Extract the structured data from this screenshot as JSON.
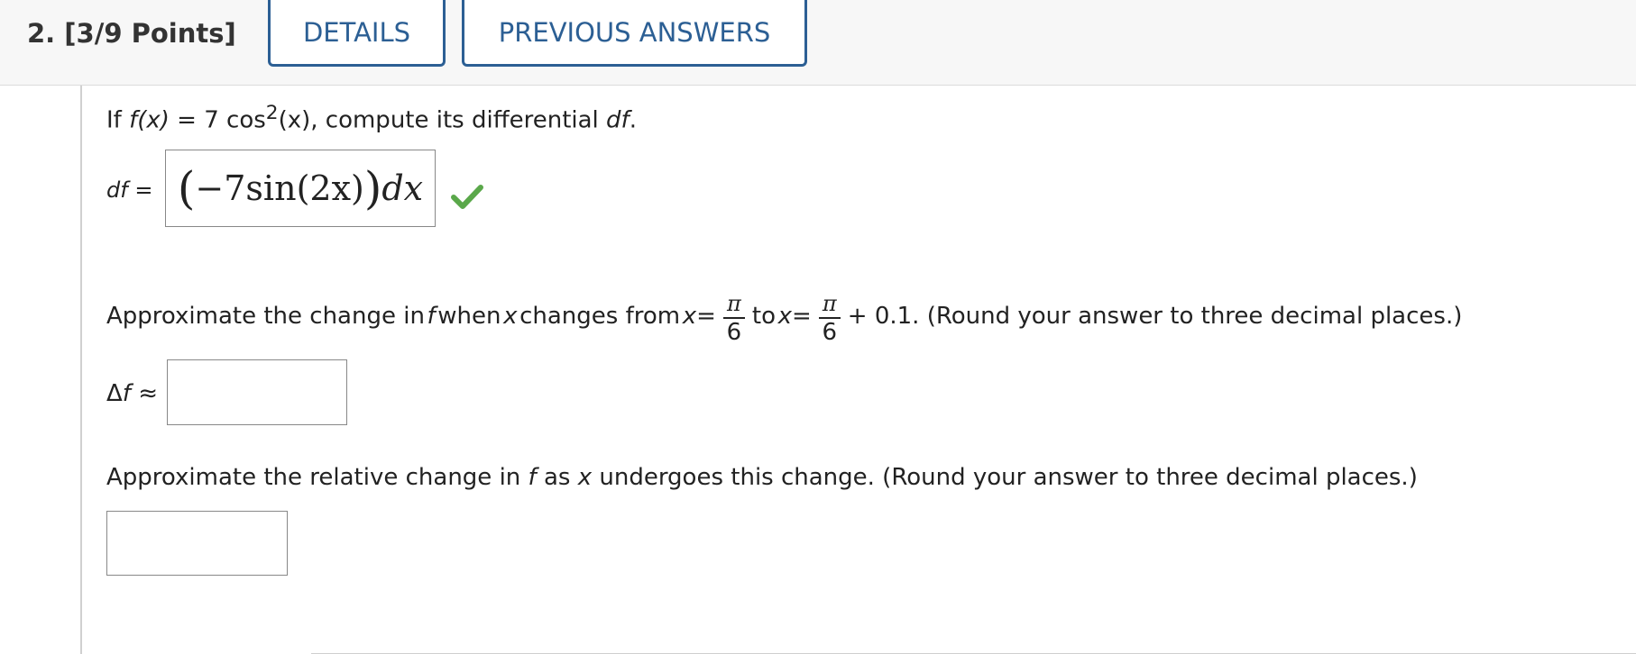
{
  "header": {
    "question_title": "2.  [3/9 Points]",
    "details_label": "DETAILS",
    "previous_answers_label": "PREVIOUS ANSWERS"
  },
  "part1": {
    "prefix": "If ",
    "fx": "f(x)",
    "equals": " = 7 cos",
    "sup": "2",
    "mid": "(x), compute its differential ",
    "df": "df",
    "suffix": ".",
    "df_label": "df =",
    "answer": {
      "open_paren": "(",
      "minus_seven": "−7",
      "sin": " sin",
      "arg": "(2x)",
      "close_paren": ")",
      "dx": "dx"
    },
    "status_icon": "check-mark-icon",
    "status_color": "#5aa84a"
  },
  "part2": {
    "text_a": "Approximate the change in ",
    "f": "f",
    "text_b": " when ",
    "x1": "x",
    "text_c": " changes from ",
    "x2": "x",
    "eq1": " =",
    "pi1": "π",
    "six1": "6",
    "to": "to ",
    "x3": "x",
    "eq2": " =",
    "pi2": "π",
    "six2": "6",
    "text_d": "+ 0.1. (Round your answer to three decimal places.)",
    "delta_label_d": "Δ",
    "delta_label_f": "f",
    "delta_label_approx": " ≈",
    "input_value": ""
  },
  "part3": {
    "text_a": "Approximate the relative change in ",
    "f": "f",
    "text_b": " as ",
    "x": "x",
    "text_c": " undergoes this change. (Round your answer to three decimal places.)",
    "input_value": ""
  }
}
